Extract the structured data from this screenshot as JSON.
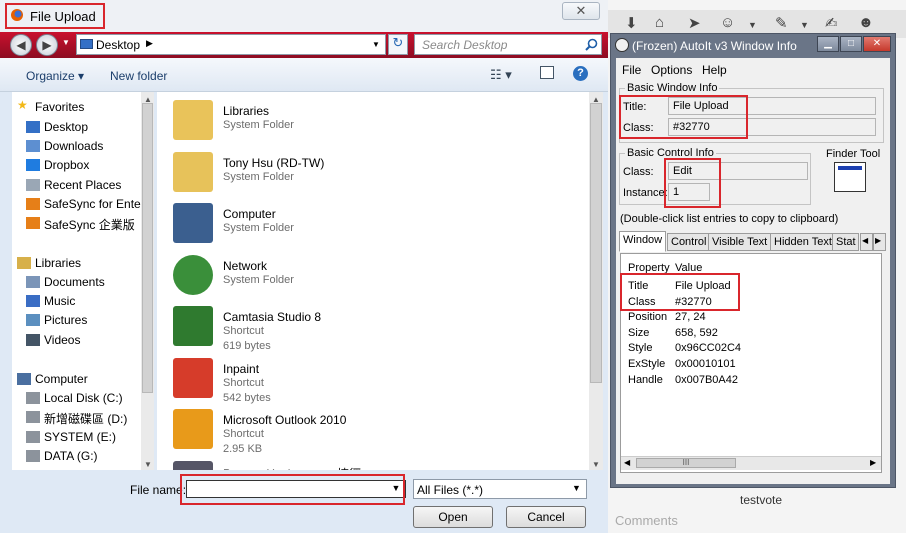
{
  "dialog": {
    "title": "File Upload",
    "close_label": "✕",
    "address": "Desktop",
    "search_placeholder": "Search Desktop",
    "toolbar": {
      "organize": "Organize ▾",
      "new_folder": "New folder"
    },
    "nav": [
      {
        "label": "Favorites",
        "head": true,
        "icon": "star-icon"
      },
      {
        "label": "Desktop",
        "icon": "desktop-icon"
      },
      {
        "label": "Downloads",
        "icon": "downloads-icon"
      },
      {
        "label": "Dropbox",
        "icon": "dropbox-icon"
      },
      {
        "label": "Recent Places",
        "icon": "recent-places-icon"
      },
      {
        "label": "SafeSync for Ente",
        "icon": "safesync-icon"
      },
      {
        "label": "SafeSync 企業版",
        "icon": "safesync-icon"
      },
      {
        "label": "Libraries",
        "head": true,
        "icon": "libraries-icon"
      },
      {
        "label": "Documents",
        "icon": "documents-icon"
      },
      {
        "label": "Music",
        "icon": "music-icon"
      },
      {
        "label": "Pictures",
        "icon": "pictures-icon"
      },
      {
        "label": "Videos",
        "icon": "videos-icon"
      },
      {
        "label": "Computer",
        "head": true,
        "icon": "computer-icon"
      },
      {
        "label": "Local Disk (C:)",
        "icon": "drive-icon"
      },
      {
        "label": "新增磁碟區 (D:)",
        "icon": "drive-icon"
      },
      {
        "label": "SYSTEM (E:)",
        "icon": "drive-icon"
      },
      {
        "label": "DATA (G:)",
        "icon": "drive-icon"
      }
    ],
    "files": [
      {
        "name": "Libraries",
        "type": "System Folder",
        "size": "",
        "icon": "libraries-folder-icon"
      },
      {
        "name": "Tony Hsu (RD-TW)",
        "type": "System Folder",
        "size": "",
        "icon": "user-folder-icon"
      },
      {
        "name": "Computer",
        "type": "System Folder",
        "size": "",
        "icon": "computer-icon"
      },
      {
        "name": "Network",
        "type": "System Folder",
        "size": "",
        "icon": "network-icon"
      },
      {
        "name": "Camtasia Studio 8",
        "type": "Shortcut",
        "size": "619 bytes",
        "icon": "camtasia-icon"
      },
      {
        "name": "Inpaint",
        "type": "Shortcut",
        "size": "542 bytes",
        "icon": "inpaint-icon"
      },
      {
        "name": "Microsoft Outlook 2010",
        "type": "Shortcut",
        "size": "2.95 KB",
        "icon": "outlook-icon"
      },
      {
        "name": "ProcessHacker.exe - 捷徑",
        "type": "",
        "size": "",
        "icon": "processhacker-icon"
      }
    ],
    "file_name_label": "File name:",
    "file_name_value": "",
    "filter": "All Files (*.*)",
    "open_label": "Open",
    "cancel_label": "Cancel"
  },
  "autoit": {
    "title": "(Frozen) AutoIt v3 Window Info",
    "menu": [
      "File",
      "Options",
      "Help"
    ],
    "basic_window_info": "Basic Window Info",
    "title_label": "Title:",
    "title_value": "File Upload",
    "class_label": "Class:",
    "class_value": "#32770",
    "basic_control_info": "Basic Control Info",
    "control_class_label": "Class:",
    "control_class_value": "Edit",
    "instance_label": "Instance:",
    "instance_value": "1",
    "finder_tool": "Finder Tool",
    "hint": "(Double-click list entries to copy to clipboard)",
    "tabs": [
      "Window",
      "Control",
      "Visible Text",
      "Hidden Text",
      "Stat"
    ],
    "list_header": {
      "property": "Property",
      "value": "Value"
    },
    "rows": [
      {
        "k": "Title",
        "v": "File Upload"
      },
      {
        "k": "Class",
        "v": "#32770"
      },
      {
        "k": "Position",
        "v": "27, 24"
      },
      {
        "k": "Size",
        "v": "658, 592"
      },
      {
        "k": "Style",
        "v": "0x96CC02C4"
      },
      {
        "k": "ExStyle",
        "v": "0x00010101"
      },
      {
        "k": "Handle",
        "v": "0x007B0A42"
      }
    ],
    "scroll_grip": "III"
  },
  "background": {
    "comments": "Comments",
    "testvote": "testvote"
  },
  "colors": {
    "highlight": "#d9262c",
    "nav_red": "#b0102a",
    "autoit_frame": "#6a7587"
  }
}
